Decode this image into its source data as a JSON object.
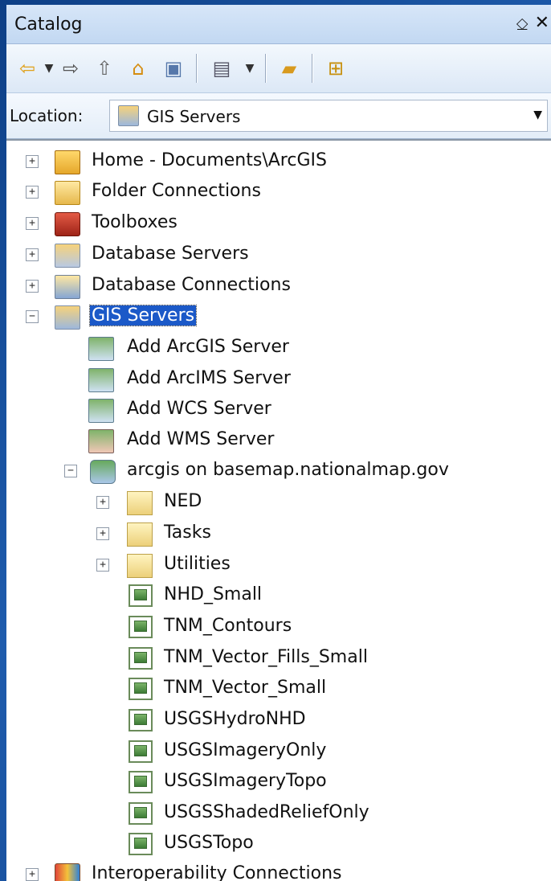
{
  "window": {
    "title": "Catalog",
    "pin_glyph": "⎐",
    "close_glyph": "✕"
  },
  "toolbar": {
    "back_icon": "back-arrow-icon",
    "forward_icon": "forward-arrow-icon",
    "up_icon": "up-one-level-icon",
    "home_icon": "home-icon",
    "toggle_contents_icon": "toggle-contents-icon",
    "views_icon": "views-icon",
    "connect_folder_icon": "connect-folder-icon",
    "tree_options_icon": "tree-options-icon"
  },
  "location": {
    "label": "Location:",
    "value": "GIS Servers"
  },
  "tree": {
    "home": "Home - Documents\\ArcGIS",
    "folder_connections": "Folder Connections",
    "toolboxes": "Toolboxes",
    "database_servers": "Database Servers",
    "database_connections": "Database Connections",
    "gis_servers": "GIS Servers",
    "add_arcgis_server": "Add ArcGIS Server",
    "add_arcims_server": "Add ArcIMS Server",
    "add_wcs_server": "Add WCS Server",
    "add_wms_server": "Add WMS Server",
    "arcgis_basemap": "arcgis on basemap.nationalmap.gov",
    "folders": [
      "NED",
      "Tasks",
      "Utilities"
    ],
    "services": [
      "NHD_Small",
      "TNM_Contours",
      "TNM_Vector_Fills_Small",
      "TNM_Vector_Small",
      "USGSHydroNHD",
      "USGSImageryOnly",
      "USGSImageryTopo",
      "USGSShadedReliefOnly",
      "USGSTopo"
    ],
    "interoperability": "Interoperability Connections"
  },
  "expander": {
    "plus": "+",
    "minus": "−"
  },
  "colors": {
    "selection": "#1b59c8",
    "desktop": "#1f5cad"
  }
}
